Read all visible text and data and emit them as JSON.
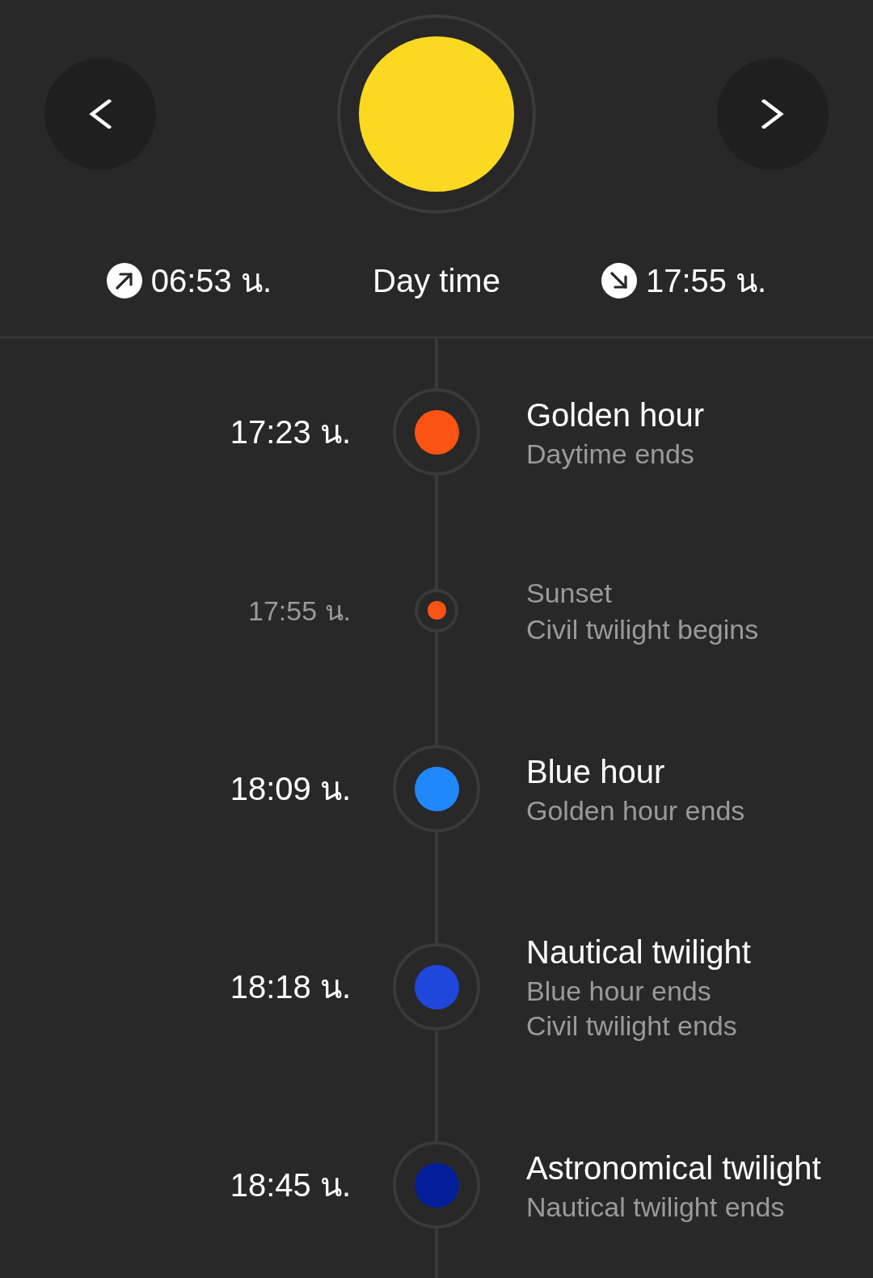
{
  "header": {
    "sunrise": "06:53 น.",
    "phase": "Day time",
    "sunset": "17:55 น."
  },
  "events": [
    {
      "kind": "major",
      "time": "17:23 น.",
      "title": "Golden hour",
      "notes": [
        "Daytime ends"
      ],
      "color": "#fb5314"
    },
    {
      "kind": "minor",
      "time": "17:55 น.",
      "title": "Sunset",
      "notes": [
        "Civil twilight begins"
      ],
      "color": "#fb5314"
    },
    {
      "kind": "major",
      "time": "18:09 น.",
      "title": "Blue hour",
      "notes": [
        "Golden hour ends"
      ],
      "color": "#2188fb"
    },
    {
      "kind": "major",
      "time": "18:18 น.",
      "title": "Nautical twilight",
      "notes": [
        "Blue hour ends",
        "Civil twilight ends"
      ],
      "color": "#1f47dc"
    },
    {
      "kind": "major",
      "time": "18:45 น.",
      "title": "Astronomical twilight",
      "notes": [
        "Nautical twilight ends"
      ],
      "color": "#021e9b"
    }
  ]
}
